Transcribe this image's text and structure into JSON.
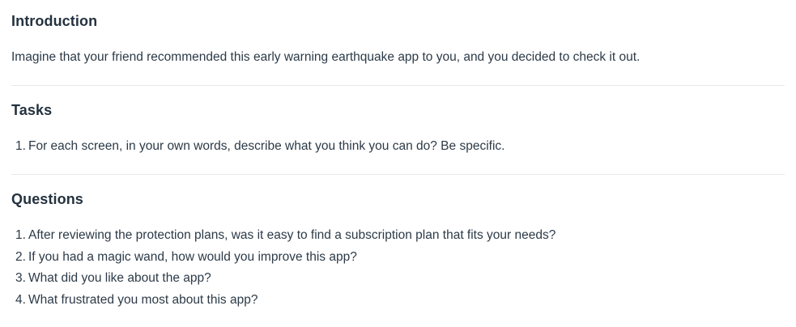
{
  "introduction": {
    "title": "Introduction",
    "text": "Imagine that your friend recommended this early warning earthquake app to you, and you decided to check it out."
  },
  "tasks": {
    "title": "Tasks",
    "items": [
      {
        "num": "1.",
        "text": "For each screen, in your own words, describe what you think you can do? Be specific."
      }
    ]
  },
  "questions": {
    "title": "Questions",
    "items": [
      {
        "num": "1.",
        "text": "After reviewing the protection plans, was it easy to find a subscription plan that fits your needs?"
      },
      {
        "num": "2.",
        "text": "If you had a magic wand, how would you improve this app?"
      },
      {
        "num": "3.",
        "text": "What did you like about the app?"
      },
      {
        "num": "4.",
        "text": "What frustrated you most about this app?"
      }
    ]
  }
}
